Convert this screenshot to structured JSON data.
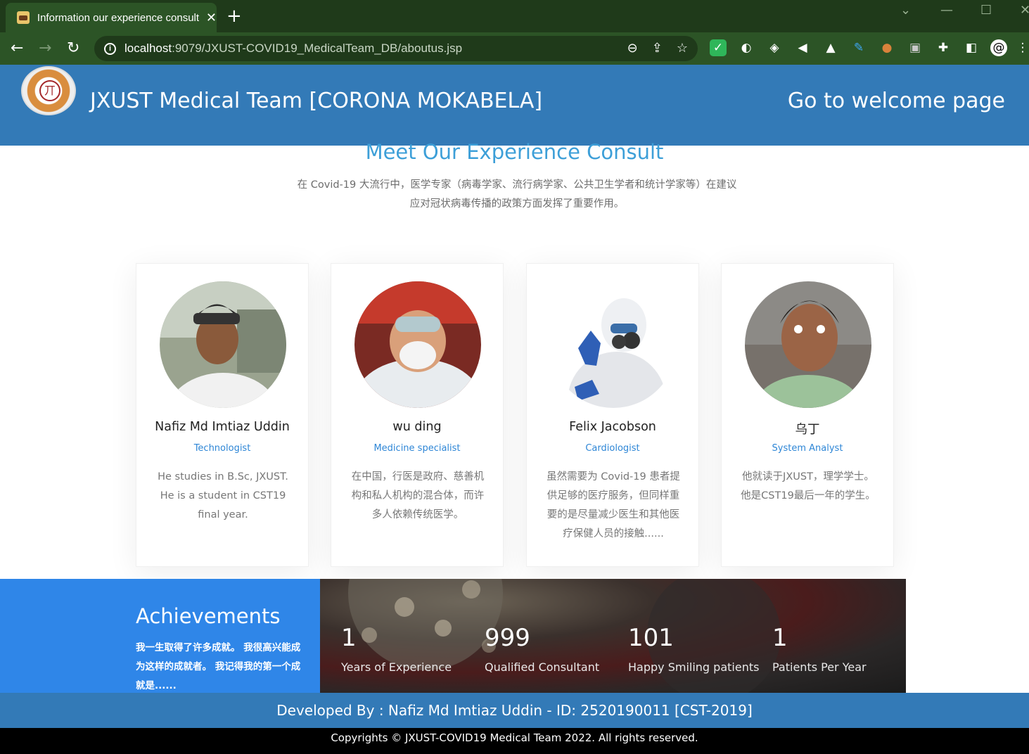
{
  "browser": {
    "tab_title": "Information our experience consult",
    "url_host": "localhost",
    "url_rest": ":9079/JXUST-COVID19_MedicalTeam_DB/aboutus.jsp"
  },
  "header": {
    "logo_glyph": "丌",
    "title": "JXUST Medical Team [CORONA MOKABELA]",
    "welcome_link": "Go to welcome page"
  },
  "section": {
    "title": "Meet Our Experience Consult",
    "subtitle": "在 Covid-19 大流行中，医学专家（病毒学家、流行病学家、公共卫生学者和统计学家等）在建议应对冠状病毒传播的政策方面发挥了重要作用。"
  },
  "cards": [
    {
      "name": "Nafiz Md Imtiaz Uddin",
      "role": "Technologist",
      "desc": "He studies in B.Sc, JXUST. He is a student in CST19 final year."
    },
    {
      "name": "wu ding",
      "role": "Medicine specialist",
      "desc": "在中国，行医是政府、慈善机构和私人机构的混合体，而许多人依赖传统医学。"
    },
    {
      "name": "Felix Jacobson",
      "role": "Cardiologist",
      "desc": "虽然需要为 Covid-19 患者提供足够的医疗服务，但同样重要的是尽量减少医生和其他医疗保健人员的接触......"
    },
    {
      "name": "乌丁",
      "role": "System Analyst",
      "desc": "他就读于JXUST，理学学士。他是CST19最后一年的学生。"
    }
  ],
  "achievements": {
    "title": "Achievements",
    "text": "我一生取得了许多成就。 我很高兴能成为这样的成就者。 我记得我的第一个成就是......",
    "stats": [
      {
        "value": "1",
        "label": "Years of Experience"
      },
      {
        "value": "999",
        "label": "Qualified Consultant"
      },
      {
        "value": "101",
        "label": "Happy Smiling patients"
      },
      {
        "value": "1",
        "label": "Patients Per Year"
      }
    ]
  },
  "footer": {
    "developed_by": "Developed By : Nafiz Md Imtiaz Uddin - ID: 2520190011 [CST-2019]",
    "copyright": "Copyrights © JXUST-COVID19 Medical Team 2022. All rights reserved."
  },
  "colors": {
    "header_blue": "#337ab7",
    "title_blue": "#3d9fd8",
    "achievement_blue": "#2f86e8",
    "browser_green": "#2c5426"
  }
}
